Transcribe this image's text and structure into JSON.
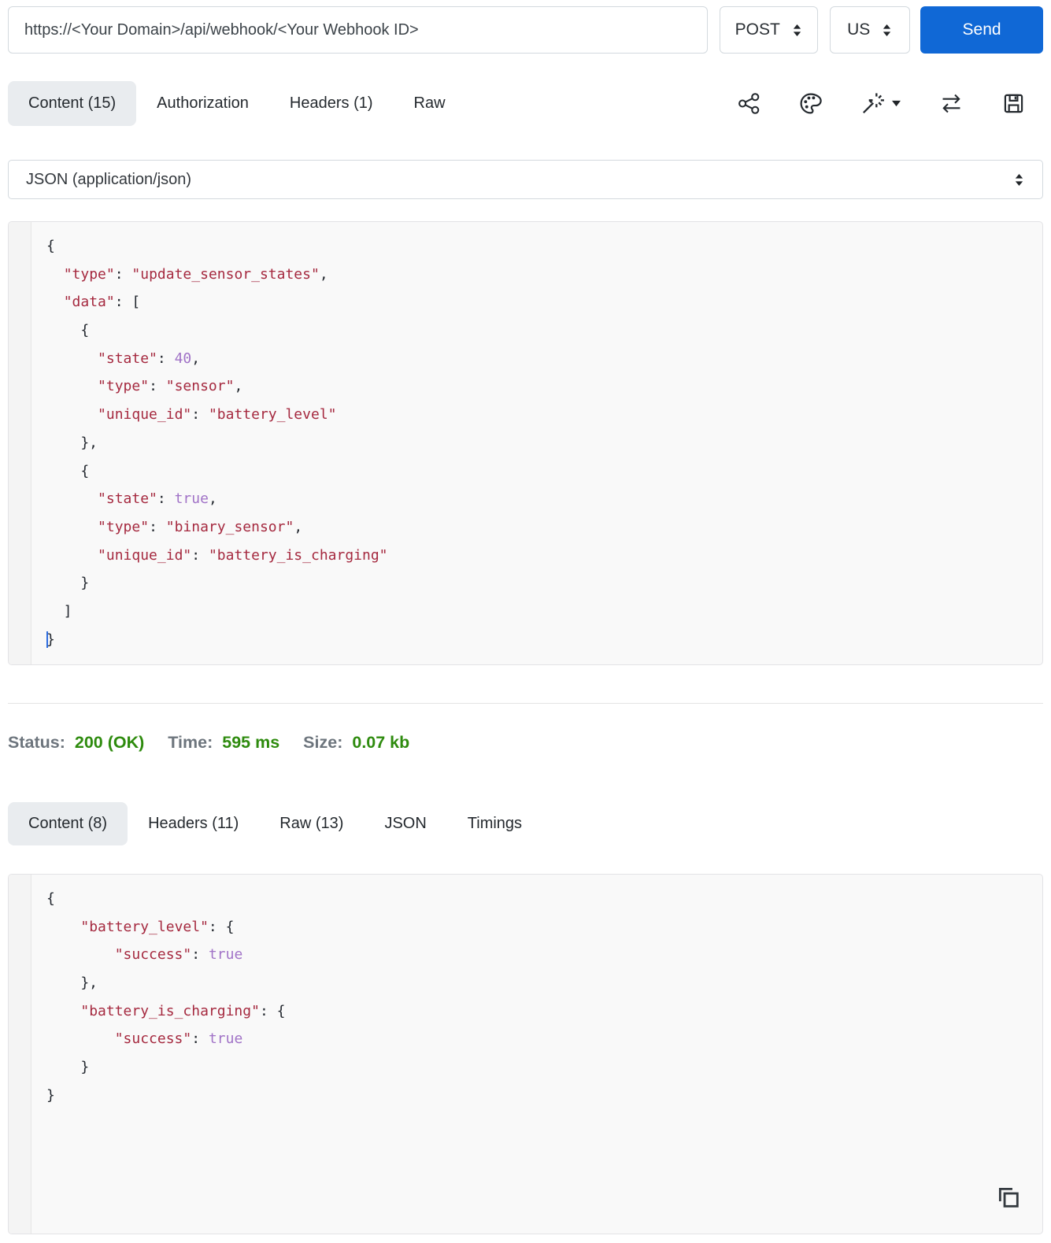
{
  "request_bar": {
    "url": "https://<Your Domain>/api/webhook/<Your Webhook ID>",
    "method": "POST",
    "region": "US",
    "send_label": "Send"
  },
  "request_tabs": [
    {
      "label": "Content (15)",
      "active": true
    },
    {
      "label": "Authorization",
      "active": false
    },
    {
      "label": "Headers (1)",
      "active": false
    },
    {
      "label": "Raw",
      "active": false
    }
  ],
  "toolbar_icons": [
    "share",
    "palette",
    "magic-wand",
    "swap-arrows",
    "save"
  ],
  "content_type": {
    "selected": "JSON (application/json)"
  },
  "request_body": {
    "lines": [
      [
        [
          "p",
          "{"
        ]
      ],
      [
        [
          "p",
          "  "
        ],
        [
          "k",
          "\"type\""
        ],
        [
          "p",
          ": "
        ],
        [
          "k",
          "\"update_sensor_states\""
        ],
        [
          "p",
          ","
        ]
      ],
      [
        [
          "p",
          "  "
        ],
        [
          "k",
          "\"data\""
        ],
        [
          "p",
          ": ["
        ]
      ],
      [
        [
          "p",
          "    {"
        ]
      ],
      [
        [
          "p",
          "      "
        ],
        [
          "k",
          "\"state\""
        ],
        [
          "p",
          ": "
        ],
        [
          "n",
          "40"
        ],
        [
          "p",
          ","
        ]
      ],
      [
        [
          "p",
          "      "
        ],
        [
          "k",
          "\"type\""
        ],
        [
          "p",
          ": "
        ],
        [
          "k",
          "\"sensor\""
        ],
        [
          "p",
          ","
        ]
      ],
      [
        [
          "p",
          "      "
        ],
        [
          "k",
          "\"unique_id\""
        ],
        [
          "p",
          ": "
        ],
        [
          "k",
          "\"battery_level\""
        ]
      ],
      [
        [
          "p",
          "    },"
        ]
      ],
      [
        [
          "p",
          "    {"
        ]
      ],
      [
        [
          "p",
          "      "
        ],
        [
          "k",
          "\"state\""
        ],
        [
          "p",
          ": "
        ],
        [
          "n",
          "true"
        ],
        [
          "p",
          ","
        ]
      ],
      [
        [
          "p",
          "      "
        ],
        [
          "k",
          "\"type\""
        ],
        [
          "p",
          ": "
        ],
        [
          "k",
          "\"binary_sensor\""
        ],
        [
          "p",
          ","
        ]
      ],
      [
        [
          "p",
          "      "
        ],
        [
          "k",
          "\"unique_id\""
        ],
        [
          "p",
          ": "
        ],
        [
          "k",
          "\"battery_is_charging\""
        ]
      ],
      [
        [
          "p",
          "    }"
        ]
      ],
      [
        [
          "p",
          "  ]"
        ]
      ],
      [
        [
          "c",
          ""
        ],
        [
          "p",
          "}"
        ]
      ]
    ]
  },
  "status_bar": {
    "status_label": "Status:",
    "status_value": "200 (OK)",
    "time_label": "Time:",
    "time_value": "595 ms",
    "size_label": "Size:",
    "size_value": "0.07 kb"
  },
  "response_tabs": [
    {
      "label": "Content (8)",
      "active": true
    },
    {
      "label": "Headers (11)",
      "active": false
    },
    {
      "label": "Raw (13)",
      "active": false
    },
    {
      "label": "JSON",
      "active": false
    },
    {
      "label": "Timings",
      "active": false
    }
  ],
  "response_body": {
    "lines": [
      [
        [
          "p",
          "{"
        ]
      ],
      [
        [
          "p",
          "    "
        ],
        [
          "k",
          "\"battery_level\""
        ],
        [
          "p",
          ": {"
        ]
      ],
      [
        [
          "p",
          "        "
        ],
        [
          "k",
          "\"success\""
        ],
        [
          "p",
          ": "
        ],
        [
          "n",
          "true"
        ]
      ],
      [
        [
          "p",
          "    },"
        ]
      ],
      [
        [
          "p",
          "    "
        ],
        [
          "k",
          "\"battery_is_charging\""
        ],
        [
          "p",
          ": {"
        ]
      ],
      [
        [
          "p",
          "        "
        ],
        [
          "k",
          "\"success\""
        ],
        [
          "p",
          ": "
        ],
        [
          "n",
          "true"
        ]
      ],
      [
        [
          "p",
          "    }"
        ]
      ],
      [
        [
          "p",
          "}"
        ]
      ]
    ]
  },
  "icons_misc": [
    "caret-updown",
    "caret-down",
    "copy"
  ],
  "colors": {
    "accent_blue": "#1068d6",
    "status_green": "#2e8b0e",
    "json_string_red": "#a5293f",
    "json_atom_purple": "#a173c7",
    "active_tab_bg": "#e9ecef"
  }
}
